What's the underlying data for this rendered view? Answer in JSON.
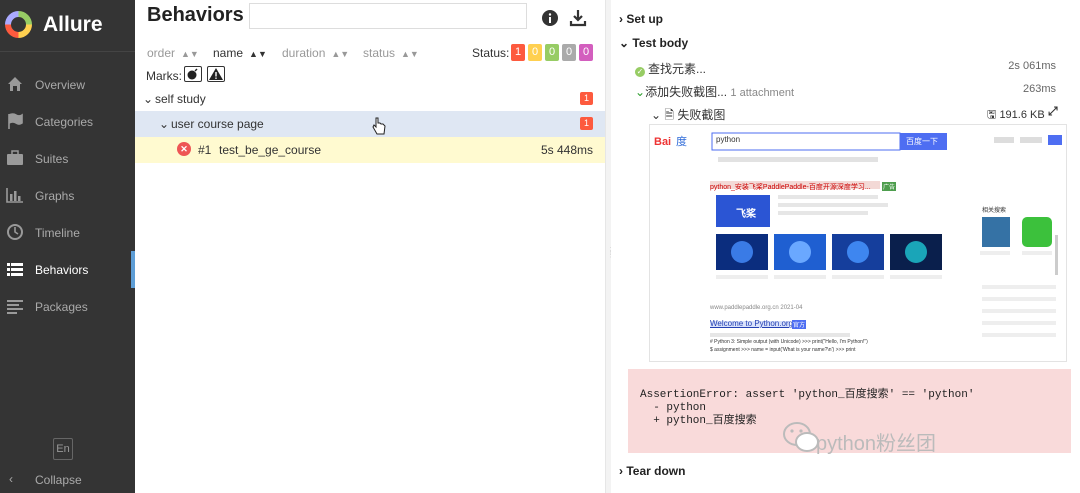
{
  "sidebar": {
    "app_name": "Allure",
    "items": [
      {
        "label": "Overview",
        "icon": "home-icon"
      },
      {
        "label": "Categories",
        "icon": "flag-icon"
      },
      {
        "label": "Suites",
        "icon": "briefcase-icon"
      },
      {
        "label": "Graphs",
        "icon": "bar-chart-icon"
      },
      {
        "label": "Timeline",
        "icon": "clock-icon"
      },
      {
        "label": "Behaviors",
        "icon": "list-icon",
        "active": true
      },
      {
        "label": "Packages",
        "icon": "align-left-icon"
      }
    ],
    "language": "En",
    "collapse_label": "Collapse"
  },
  "behaviors": {
    "title": "Behaviors",
    "search_value": "",
    "sort": {
      "order": "order",
      "name": "name",
      "duration": "duration",
      "status": "status"
    },
    "status_label": "Status:",
    "status_counts": [
      "1",
      "0",
      "0",
      "0",
      "0"
    ],
    "status_colors": [
      "#fd5a3e",
      "#ffd050",
      "#97cc64",
      "#aaaaaa",
      "#d35ebe"
    ],
    "marks_label": "Marks:",
    "tree": {
      "epic": {
        "label": "self study",
        "count": "1"
      },
      "feature": {
        "label": "user course page",
        "count": "1"
      },
      "test": {
        "index": "#1",
        "name": "test_be_ge_course",
        "duration": "5s 448ms"
      }
    }
  },
  "detail": {
    "setup_label": "Set up",
    "body_label": "Test body",
    "steps": [
      {
        "label": "查找元素...",
        "time": "2s 061ms"
      },
      {
        "label": "添加失败截图...",
        "attachment": "1 attachment",
        "time": "263ms"
      }
    ],
    "attachment": {
      "name": "失败截图",
      "size": "191.6 KB"
    },
    "screenshot": {
      "search_query": "python",
      "search_button": "百度一下",
      "result_title": "python_安装飞桨PaddlePaddle-百度开源深度学习...",
      "result_badge": "广告",
      "paddle_logo": "飞桨",
      "second_title": "Welcome to Python.org",
      "second_badge": "官方",
      "side_header": "相关搜索",
      "line_1": "# Python 3: Simple output (with Unicode) >>> print(\"Hello, I'm Python!\")",
      "line_2": "$ assignment >>> name = input('What is your name?\\n') >>> print",
      "url_line": "www.paddlepaddle.org.cn 2021-04"
    },
    "error_lines": [
      "AssertionError: assert 'python_百度搜索' == 'python'",
      "  - python",
      "  + python_百度搜索"
    ],
    "watermark": "python粉丝团",
    "teardown_label": "Tear down"
  }
}
